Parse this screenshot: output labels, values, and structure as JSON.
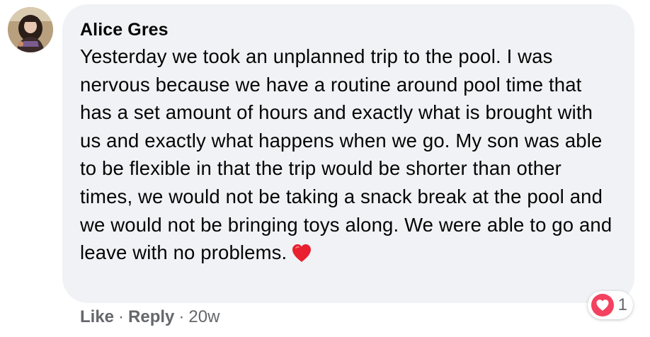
{
  "comment": {
    "author": "Alice Gres",
    "text": "Yesterday we took an unplanned trip to the pool. I was nervous because we have a routine around pool time that has a set amount of hours and exactly what is brought with us and exactly what happens when we go. My son was able to be flexible in that the trip would be shorter than other times, we would not be taking a snack break at the pool and we would not be bringing toys along. We were able to go and leave with no problems.",
    "text_emoji": "heart-icon",
    "avatar_icon": "user-avatar"
  },
  "reactions": {
    "icon": "love-reaction-icon",
    "count": "1"
  },
  "actions": {
    "like_label": "Like",
    "separator": "·",
    "reply_label": "Reply",
    "time": "20w"
  },
  "colors": {
    "bubble_bg": "#f0f2f5",
    "text": "#050505",
    "secondary": "#65676b",
    "love_red": "#f3425f",
    "heart_red": "#e8202f"
  }
}
